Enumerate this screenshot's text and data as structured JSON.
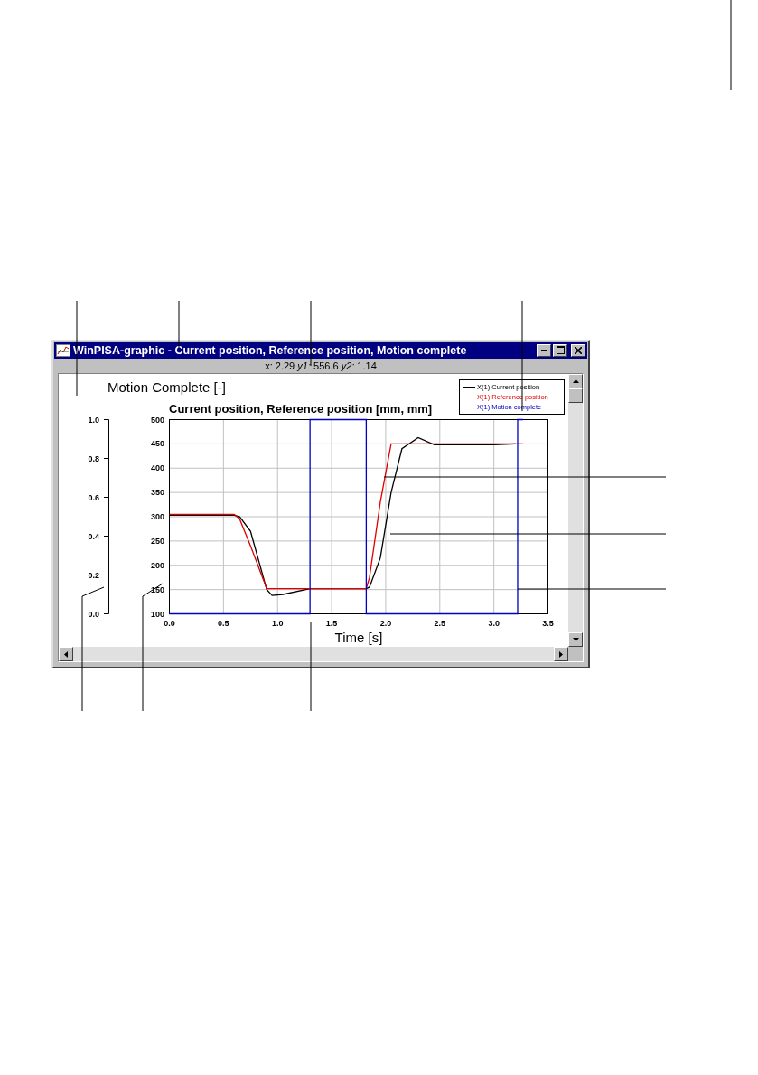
{
  "window": {
    "title": "WinPISA-graphic - Current position, Reference position, Motion complete"
  },
  "status": "x: 2.29 *y1:* 556.6 *y2:* 1.14",
  "chart": {
    "chart_data": {
      "type": "line",
      "title": "Current position, Reference position [mm, mm]",
      "xlabel": "Time [s]",
      "annotations": [
        {
          "text": "Motion Complete [-]"
        }
      ],
      "grid": true,
      "legend": true,
      "x": [
        0,
        0.6,
        0.65,
        0.75,
        0.9,
        0.95,
        1.05,
        1.3,
        1.3,
        1.82,
        1.82,
        1.85,
        1.95,
        2.05,
        2.15,
        2.3,
        2.45,
        3.0,
        3.2,
        3.22,
        3.22,
        3.27
      ],
      "xlim": [
        0,
        3.5
      ],
      "ylim": [
        0,
        1
      ],
      "y2lim": [
        100,
        500
      ],
      "xticks": [
        {
          "value": 0,
          "label": "0.0"
        },
        {
          "value": 0.5,
          "label": "0.5"
        },
        {
          "value": 1,
          "label": "1.0"
        },
        {
          "value": 1.5,
          "label": "1.5"
        },
        {
          "value": 2,
          "label": "2.0"
        },
        {
          "value": 2.5,
          "label": "2.5"
        },
        {
          "value": 3,
          "label": "3.0"
        },
        {
          "value": 3.5,
          "label": "3.5"
        }
      ],
      "yticks": [
        {
          "value": 0,
          "label": "0.0"
        },
        {
          "value": 0.2,
          "label": "0.2"
        },
        {
          "value": 0.4,
          "label": "0.4"
        },
        {
          "value": 0.6,
          "label": "0.6"
        },
        {
          "value": 0.8,
          "label": "0.8"
        },
        {
          "value": 1,
          "label": "1.0"
        }
      ],
      "y2ticks": [
        100,
        150,
        200,
        250,
        300,
        350,
        400,
        450,
        500
      ],
      "series": [
        {
          "name": "X(1) Current position",
          "color": "#000000",
          "axis": "y2",
          "values": [
            303,
            303,
            300,
            270,
            150,
            138,
            140,
            152,
            152,
            152,
            152,
            155,
            215,
            350,
            440,
            463,
            448,
            448,
            450,
            null,
            null,
            null
          ]
        },
        {
          "name": "X(1) Reference position",
          "color": "#e00000",
          "axis": "y2",
          "values": [
            305,
            305,
            295,
            240,
            152,
            152,
            152,
            152,
            152,
            152,
            152,
            175,
            330,
            450,
            450,
            450,
            450,
            450,
            450,
            450,
            450,
            450
          ]
        },
        {
          "name": "X(1) Motion complete",
          "color": "#0000c0",
          "axis": "y",
          "values": [
            0,
            0,
            0,
            0,
            0,
            0,
            0,
            0,
            1,
            1,
            0,
            0,
            0,
            0,
            0,
            0,
            0,
            0,
            0,
            0,
            1,
            1
          ]
        }
      ]
    }
  }
}
